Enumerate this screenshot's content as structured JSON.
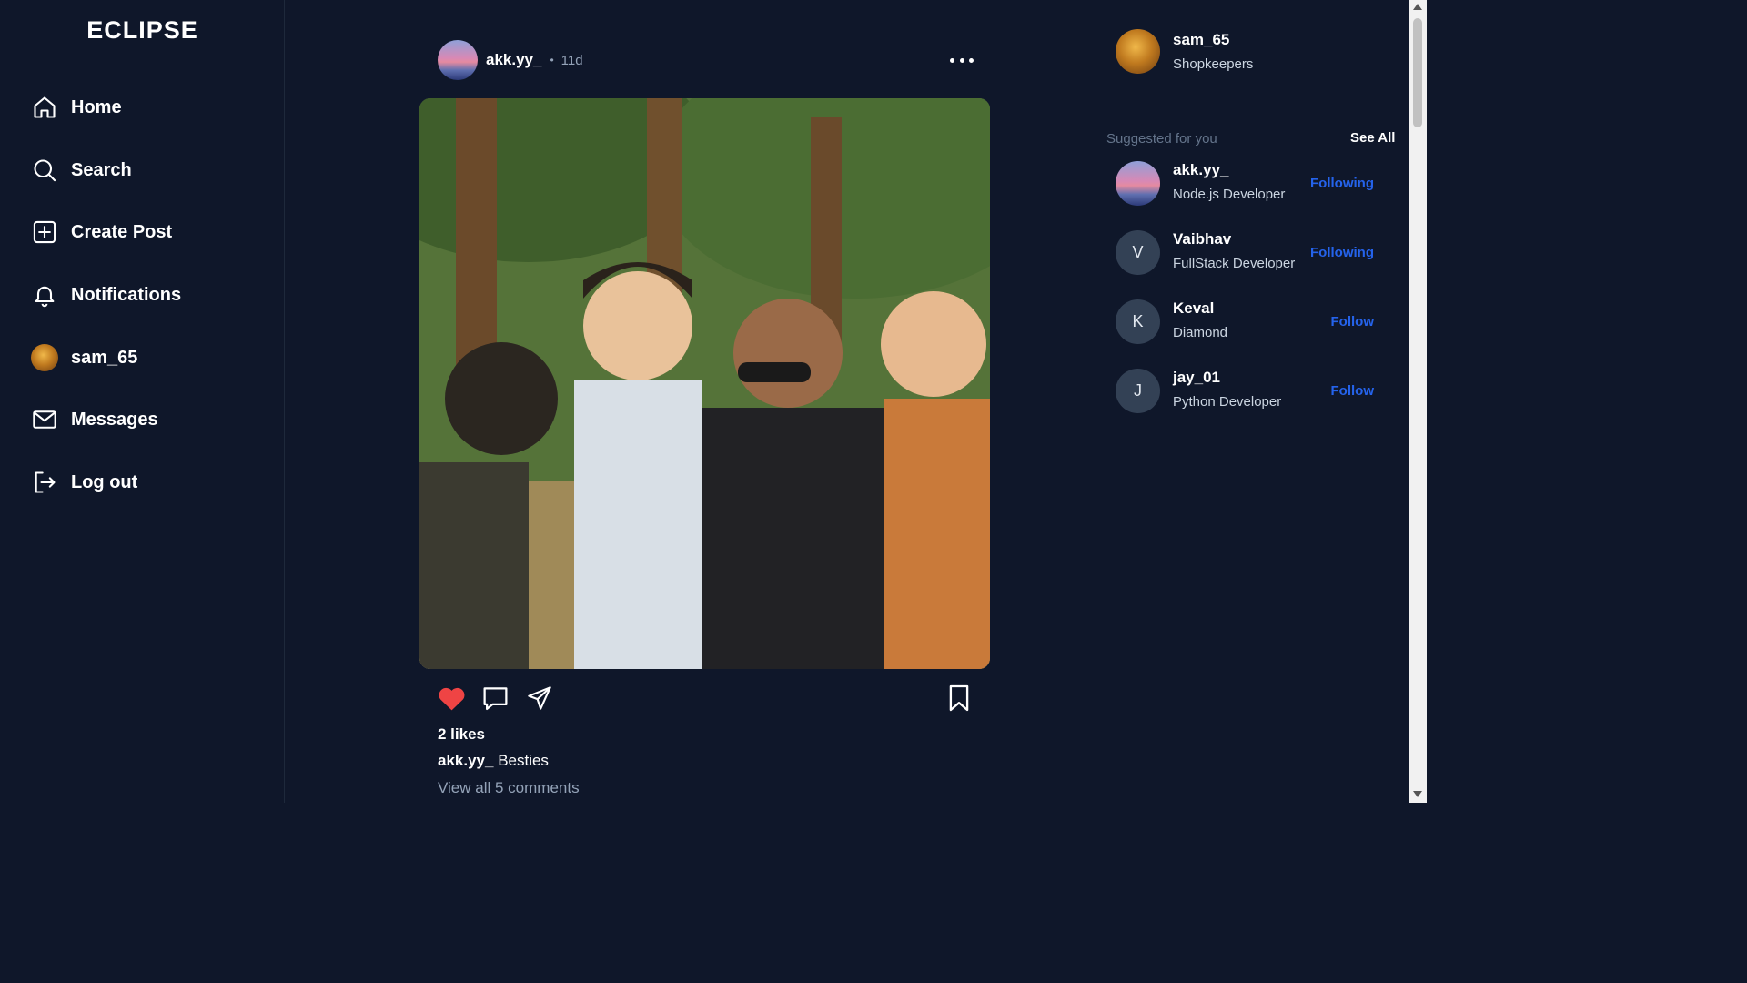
{
  "app": {
    "logo": "ECLIPSE"
  },
  "sidebar": {
    "items": [
      {
        "label": "Home",
        "icon": "home-icon"
      },
      {
        "label": "Search",
        "icon": "search-icon"
      },
      {
        "label": "Create Post",
        "icon": "plus-square-icon"
      },
      {
        "label": "Notifications",
        "icon": "bell-icon"
      },
      {
        "label": "sam_65",
        "icon": "avatar"
      },
      {
        "label": "Messages",
        "icon": "mail-icon"
      },
      {
        "label": "Log out",
        "icon": "logout-icon"
      }
    ]
  },
  "post": {
    "username": "akk.yy_",
    "separator": "•",
    "time": "11d",
    "image_desc_icon": "post-photo",
    "liked": true,
    "like_color": "#ef4444",
    "likes": "2 likes",
    "caption_user": "akk.yy_",
    "caption_text": "Besties",
    "view_comments": "View all 5 comments"
  },
  "current_user": {
    "username": "sam_65",
    "subtitle": "Shopkeepers"
  },
  "suggestions": {
    "title": "Suggested for you",
    "see_all": "See All",
    "items": [
      {
        "username": "akk.yy_",
        "subtitle": "Node.js Developer",
        "action": "Following",
        "avatar": "image"
      },
      {
        "username": "Vaibhav",
        "subtitle": "FullStack Developer",
        "action": "Following",
        "avatar": "V"
      },
      {
        "username": "Keval",
        "subtitle": "Diamond",
        "action": "Follow",
        "avatar": "K"
      },
      {
        "username": "jay_01",
        "subtitle": "Python Developer",
        "action": "Follow",
        "avatar": "J"
      }
    ]
  },
  "colors": {
    "background": "#0f172a",
    "accent": "#2563eb",
    "muted": "#94a3b8"
  }
}
